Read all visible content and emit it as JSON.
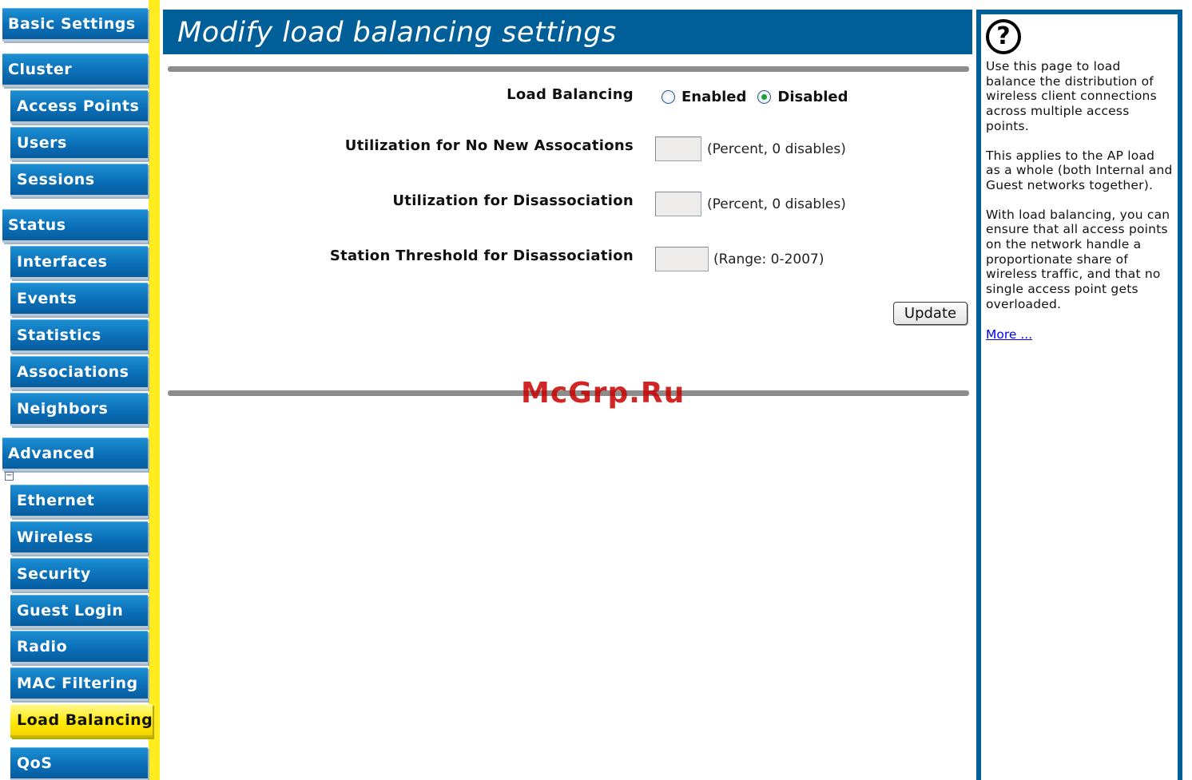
{
  "sidebar": {
    "basic_settings": "Basic Settings",
    "cluster": "Cluster",
    "access_points": "Access Points",
    "users": "Users",
    "sessions": "Sessions",
    "status": "Status",
    "interfaces": "Interfaces",
    "events": "Events",
    "statistics": "Statistics",
    "associations": "Associations",
    "neighbors": "Neighbors",
    "advanced": "Advanced",
    "collapse_symbol": "−",
    "ethernet": "Ethernet",
    "wireless": "Wireless",
    "security": "Security",
    "guest_login": "Guest Login",
    "radio": "Radio",
    "mac_filtering": "MAC Filtering",
    "load_balancing": "Load Balancing",
    "qos": "QoS",
    "active_item": "Load Balancing",
    "accent_color": "#ffec1e",
    "button_color": "#0a6fb8"
  },
  "main": {
    "title": "Modify load balancing settings",
    "title_bar_color": "#005f99",
    "load_balancing": {
      "label": "Load Balancing",
      "enabled_label": "Enabled",
      "disabled_label": "Disabled",
      "selected": "Disabled"
    },
    "no_new_assoc": {
      "label": "Utilization for No New Assocations",
      "value": "",
      "hint": "(Percent, 0 disables)"
    },
    "disassoc": {
      "label": "Utilization for Disassociation",
      "value": "",
      "hint": "(Percent, 0 disables)"
    },
    "station_threshold": {
      "label": "Station Threshold for Disassociation",
      "value": "",
      "hint": "(Range: 0-2007)"
    },
    "update_button": "Update",
    "watermark": "McGrp.Ru"
  },
  "help": {
    "icon": "?",
    "p1": "Use this page to load balance the distribution of wireless client connections across multiple access points.",
    "p2": "This applies to the AP load as a whole (both Internal and Guest networks together).",
    "p3": "With load balancing, you can ensure that all access points on the network handle a proportionate share of wireless traffic, and that no single access point gets overloaded.",
    "more_link": "More ..."
  }
}
